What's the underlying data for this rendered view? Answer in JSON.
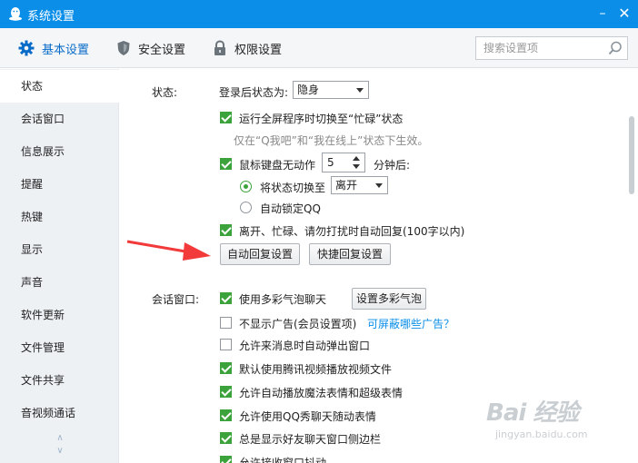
{
  "window": {
    "title": "系统设置"
  },
  "tabs": [
    {
      "label": "基本设置",
      "active": true
    },
    {
      "label": "安全设置"
    },
    {
      "label": "权限设置"
    }
  ],
  "search": {
    "placeholder": "搜索设置项",
    "value": ""
  },
  "sidebar": {
    "items": [
      {
        "label": "状态",
        "active": true
      },
      {
        "label": "会话窗口"
      },
      {
        "label": "信息展示"
      },
      {
        "label": "提醒"
      },
      {
        "label": "热键"
      },
      {
        "label": "显示"
      },
      {
        "label": "声音"
      },
      {
        "label": "软件更新"
      },
      {
        "label": "文件管理"
      },
      {
        "label": "文件共享"
      },
      {
        "label": "音视频通话"
      }
    ]
  },
  "status": {
    "section_label": "状态:",
    "login_label": "登录后状态为:",
    "login_value": "隐身",
    "fullscreen_label": "运行全屏程序时切换至“忙碌”状态",
    "fullscreen_checked": true,
    "fullscreen_hint": "仅在“Q我吧”和“我在线上”状态下生效。",
    "idle_label": "鼠标键盘无动作",
    "idle_checked": true,
    "idle_minutes": "5",
    "idle_suffix": "分钟后:",
    "switch_label": "将状态切换至",
    "switch_value": "离开",
    "lock_label": "自动锁定QQ",
    "autoreply_label": "离开、忙碌、请勿打扰时自动回复(100字以内)",
    "autoreply_checked": true,
    "autoreply_button": "自动回复设置",
    "quickreply_button": "快捷回复设置"
  },
  "chat": {
    "section_label": "会话窗口:",
    "bubble_label": "使用多彩气泡聊天",
    "bubble_button": "设置多彩气泡",
    "noad_label": "不显示广告(会员设置项)",
    "noad_link": "可屏蔽哪些广告？",
    "popup_label": "允许来消息时自动弹出窗口",
    "video_label": "默认使用腾讯视频播放视频文件",
    "magic_label": "允许自动播放魔法表情和超级表情",
    "show_label": "允许使用QQ秀聊天随动表情",
    "sidebar_label": "总是显示好友聊天窗口侧边栏",
    "shake_label": "允许接收窗口抖动"
  },
  "watermark": {
    "main": "Bai 经验",
    "sub": "jingyan.baidu.com"
  },
  "colors": {
    "titlebar": "#0a8ee8",
    "accent": "#0a6cc9",
    "check": "#3ca33c",
    "link": "#0a8ee8",
    "arrow": "#f23a3a"
  }
}
